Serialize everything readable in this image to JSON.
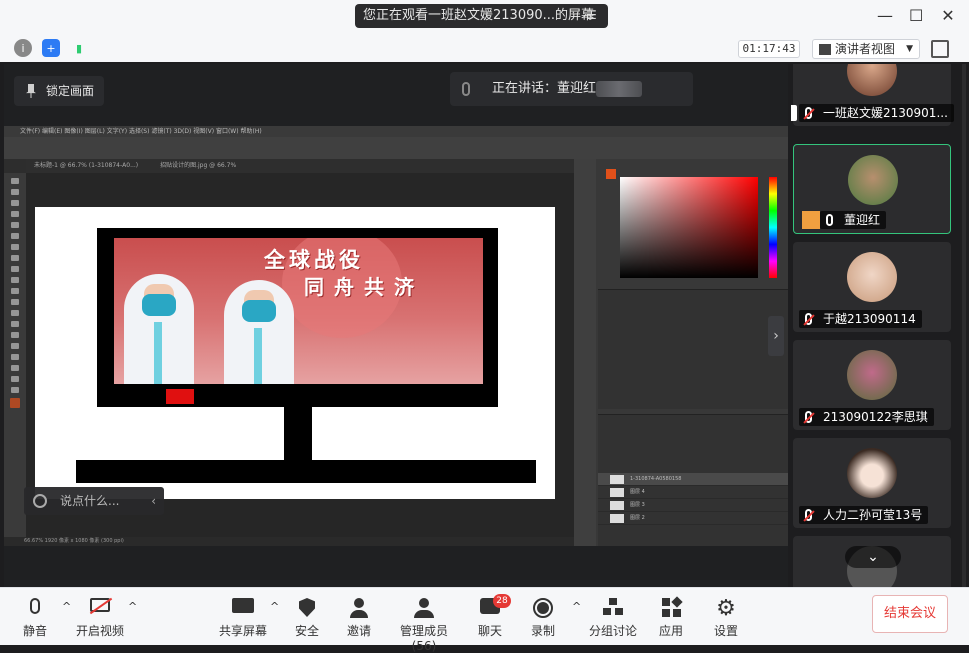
{
  "window": {
    "title": "您正在观看一班赵文媛213090...的屏幕",
    "timer": "01:17:43",
    "view_mode": "演讲者视图"
  },
  "stage": {
    "lock_label": "锁定画面",
    "speaking_label": "正在讲话：董迎红；",
    "chat_placeholder": "说点什么..."
  },
  "shared_screen": {
    "poster_line1": "全球战役",
    "poster_line2": "同舟共济",
    "ps_tab1": "未标题-1 @ 66.7% (1-310874-A0...)",
    "ps_tab2": "招贴设计的图.jpg @ 66.7%",
    "ps_zoom_status": "66.67%   1920 像素 x 1080 像素 (300 ppi)",
    "layers": [
      "1-310874-A0580158",
      "图层 4",
      "图层 3",
      "图层 2"
    ]
  },
  "participants": [
    {
      "name": "一班赵文媛2130901...",
      "muted": true,
      "sharing": true
    },
    {
      "name": "董迎红",
      "muted": false,
      "host": true
    },
    {
      "name": "于越213090114",
      "muted": true
    },
    {
      "name": "213090122李思琪",
      "muted": true
    },
    {
      "name": "人力二孙可莹13号",
      "muted": true
    }
  ],
  "toolbar": {
    "mute": "静音",
    "video": "开启视频",
    "share": "共享屏幕",
    "security": "安全",
    "invite": "邀请",
    "members": "管理成员 (56)",
    "chat": "聊天",
    "chat_badge": "28",
    "record": "录制",
    "breakout": "分组讨论",
    "apps": "应用",
    "settings": "设置",
    "end": "结束会议"
  },
  "colors": {
    "accent_green": "#34c47c",
    "end_red": "#e53935",
    "badge_red": "#e53935"
  }
}
